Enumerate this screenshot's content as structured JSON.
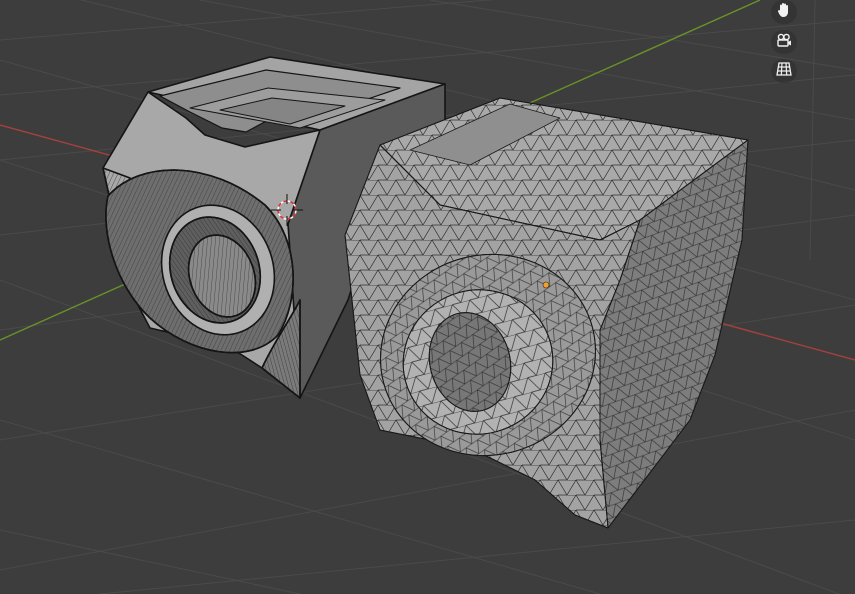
{
  "viewport": {
    "background": "#3d3d3d",
    "grid_color": "#4b4b4b",
    "axis_x_color": "#b3413f",
    "axis_y_color": "#6f9a2a",
    "selection_origin_color": "#f0a030"
  },
  "navigation_gizmo": {
    "buttons": [
      {
        "name": "pan-view",
        "icon": "hand-icon"
      },
      {
        "name": "toggle-camera-view",
        "icon": "camera-icon"
      },
      {
        "name": "toggle-orthographic",
        "icon": "grid-icon"
      }
    ]
  },
  "objects": [
    {
      "name": "original-mesh",
      "shading": "solid",
      "wireframe": "sparse"
    },
    {
      "name": "remeshed-object",
      "shading": "solid",
      "wireframe": "dense triangles"
    }
  ]
}
